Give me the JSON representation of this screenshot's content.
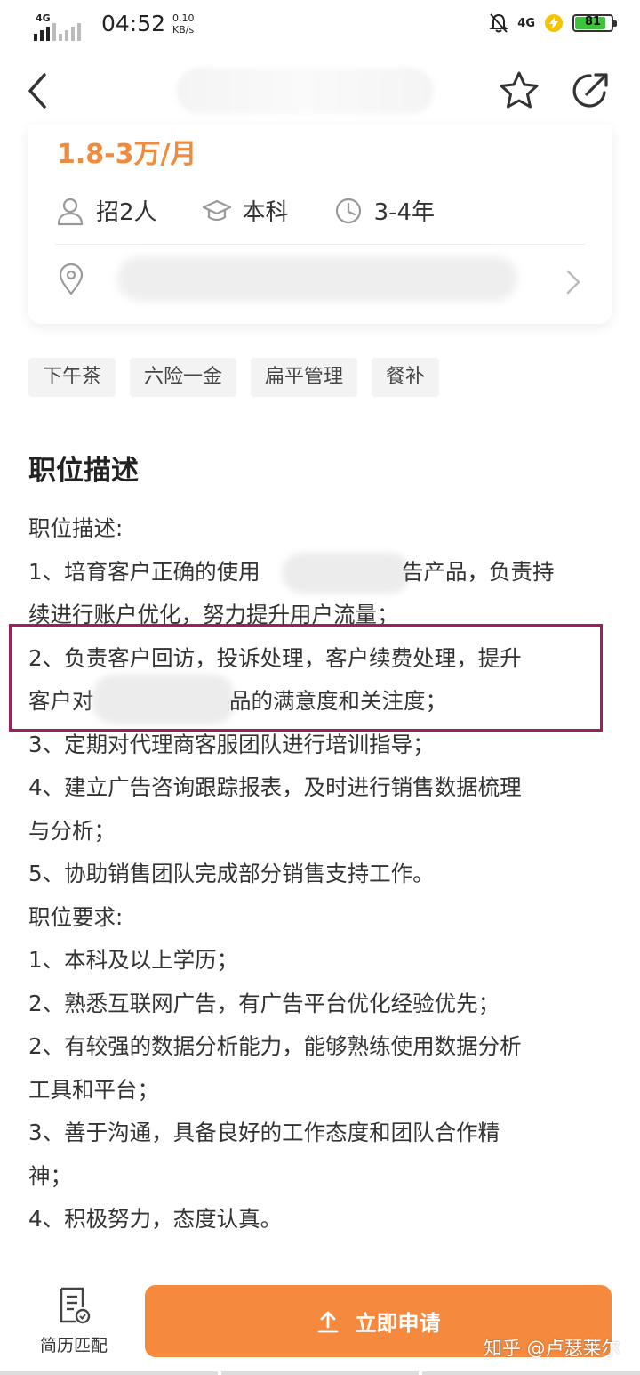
{
  "status_bar": {
    "network_left": "4G",
    "time": "04:52",
    "speed_value": "0.10",
    "speed_unit": "KB/s",
    "network_right": "4G",
    "battery": "81"
  },
  "job": {
    "salary": "1.8-3万/月",
    "headcount": "招2人",
    "education": "本科",
    "experience": "3-4年"
  },
  "tags": [
    "下午茶",
    "六险一金",
    "扁平管理",
    "餐补"
  ],
  "description": {
    "heading": "职位描述",
    "lines": [
      "职位描述:",
      "1、培育客户正确的使用",
      "告产品，负责持",
      "续进行账户优化，努力提升用户流量；",
      "2、负责客户回访，投诉处理，客户续费处理，提升",
      "客户对",
      "品的满意度和关注度；",
      "3、定期对代理商客服团队进行培训指导；",
      "4、建立广告咨询跟踪报表，及时进行销售数据梳理",
      "与分析；",
      "5、协助销售团队完成部分销售支持工作。",
      "职位要求:",
      "1、本科及以上学历；",
      "2、熟悉互联网广告，有广告平台优化经验优先；",
      "2、有较强的数据分析能力，能够熟练使用数据分析",
      "工具和平台；",
      "3、善于沟通，具备良好的工作态度和团队合作精",
      "神；",
      "4、积极努力，态度认真。"
    ]
  },
  "bottom": {
    "resume_match": "简历匹配",
    "apply": "立即申请",
    "watermark": "知乎 @卢瑟莱尔"
  },
  "colors": {
    "accent": "#f58a3f",
    "salary": "#f08a3c",
    "highlight_border": "#a01e5f"
  }
}
